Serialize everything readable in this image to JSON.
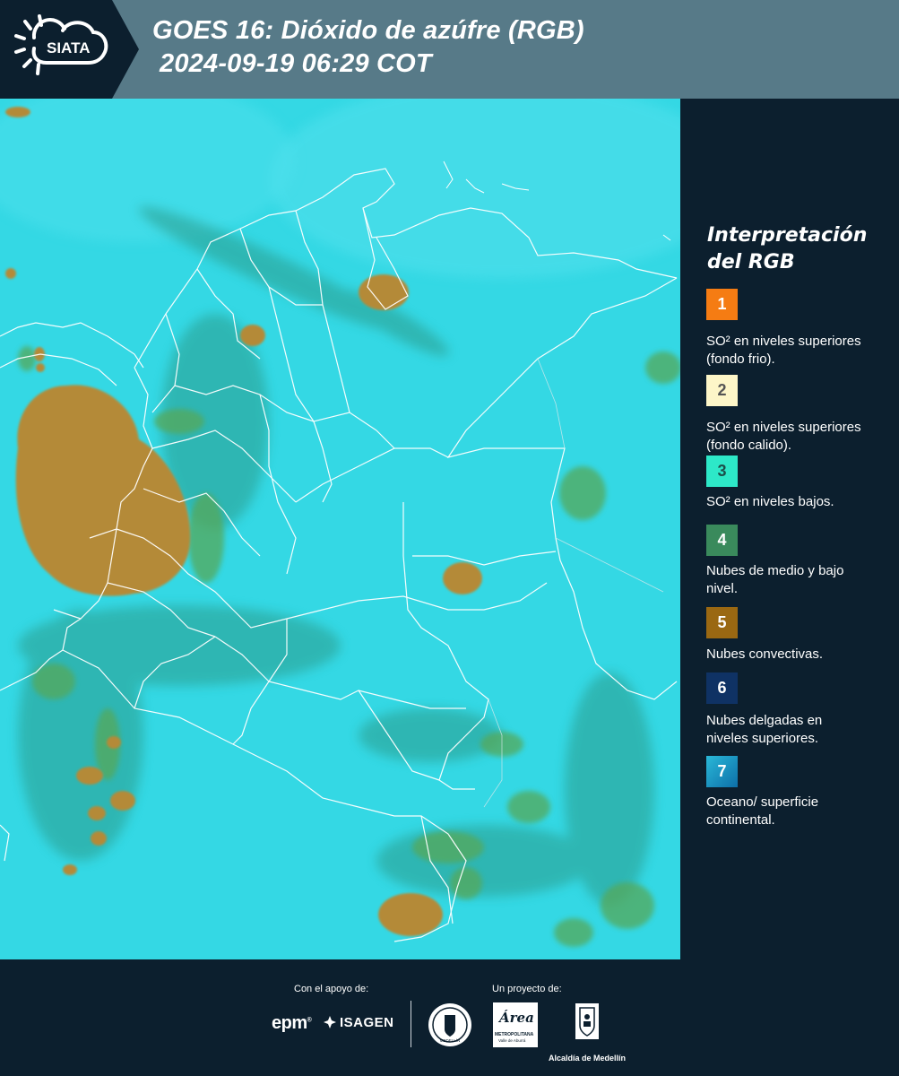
{
  "header": {
    "logo_text": "SIATA",
    "title_line1": "GOES 16: Dióxido de azúfre (RGB)",
    "title_line2": "2024-09-19 06:29 COT",
    "background_color": "#577a88",
    "logo_block_color": "#0c1f2e"
  },
  "legend": {
    "title_line1": "Interpretación",
    "title_line2": "del RGB",
    "items": [
      {
        "number": "1",
        "label": "SO² en niveles superiores (fondo frio).",
        "color": "#f57c13",
        "text_color": "#ffffff"
      },
      {
        "number": "2",
        "label": "SO² en niveles superiores (fondo calido).",
        "color": "#fdf6c8",
        "text_color": "#555555"
      },
      {
        "number": "3",
        "label": "SO² en niveles bajos.",
        "color": "#2de8c8",
        "text_color": "#1c4f4a"
      },
      {
        "number": "4",
        "label": "Nubes de medio y bajo nivel.",
        "color": "#3a8a5c",
        "text_color": "#ffffff"
      },
      {
        "number": "5",
        "label": "Nubes convectivas.",
        "color": "#9a6812",
        "text_color": "#ffffff"
      },
      {
        "number": "6",
        "label": "Nubes delgadas en niveles superiores.",
        "color": "#0f3264",
        "text_color": "#ffffff"
      },
      {
        "number": "7",
        "label": "Oceano/ superficie continental.",
        "color": "#1a9ac4",
        "text_color": "#ffffff"
      }
    ]
  },
  "map": {
    "background_color": "#2fd6e2",
    "convective_color": "#b48c3a",
    "green_cloud_color": "#4ea860",
    "border_color": "#ffffff"
  },
  "footer": {
    "support_caption": "Con el apoyo de:",
    "project_caption": "Un proyecto de:",
    "epm_text": "epm",
    "isagen_text": "ISAGEN",
    "area_text": "Área",
    "area_subtext": "METROPOLITANA",
    "area_subtext2": "Valle de Aburrá",
    "alcaldia_text": "Alcaldía de Medellín",
    "seal_text": "MEDELLÍN"
  }
}
